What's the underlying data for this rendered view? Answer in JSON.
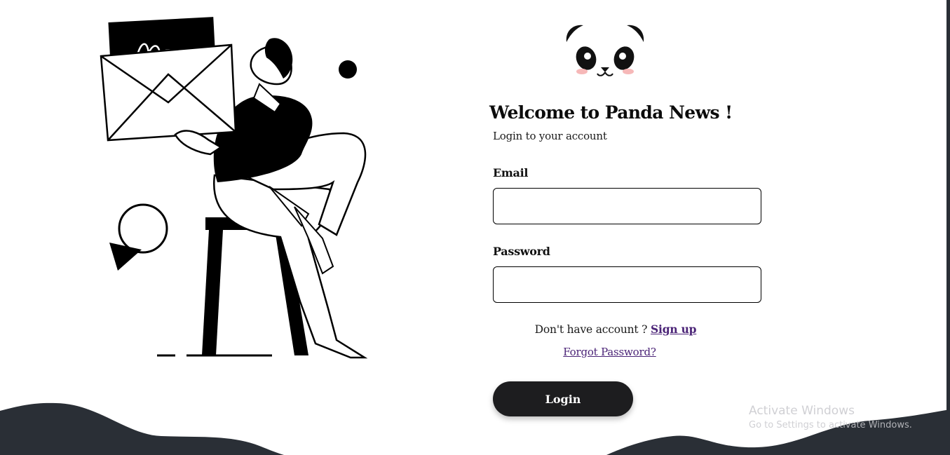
{
  "login": {
    "title": "Welcome to Panda News !",
    "subtitle": "Login to your account",
    "email_label": "Email",
    "email_value": "",
    "password_label": "Password",
    "password_value": "",
    "signup_prompt": "Don't have account ?",
    "signup_link": "Sign up",
    "forgot_link": "Forgot Password?",
    "login_button": "Login"
  },
  "watermark": {
    "title": "Activate Windows",
    "subtitle": "Go to Settings to activate Windows."
  },
  "colors": {
    "dark": "#2a2f36",
    "button": "#1d1d1f",
    "link": "#4b2477",
    "blush": "#f6b8b8"
  },
  "icons": {
    "logo": "panda-face",
    "illustration": "person-holding-envelope"
  }
}
